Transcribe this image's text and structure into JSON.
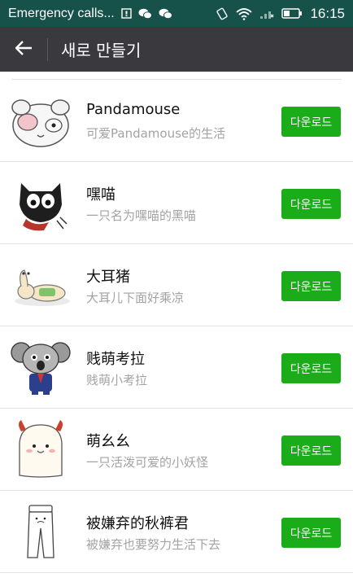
{
  "status_bar": {
    "carrier": "Emergency calls...",
    "time": "16:15",
    "left_icons": [
      "notification-icon",
      "wechat-icon",
      "wechat-icon"
    ],
    "right_icons": [
      "vibrate-icon",
      "wifi-icon",
      "signal-icon",
      "battery-icon"
    ]
  },
  "header": {
    "back_icon": "back-arrow-icon",
    "title": "새로 만들기"
  },
  "colors": {
    "status_bar": "#16514a",
    "title_bar": "#3a3a3e",
    "accent_green": "#1aad19"
  },
  "sticker_packs": [
    {
      "title": "Pandamouse",
      "desc": "可爱Pandamouse的生活",
      "button": "다운로드",
      "thumb": "pandamouse-icon"
    },
    {
      "title": "嘿喵",
      "desc": "一只名为嘿喵的黑喵",
      "button": "다운로드",
      "thumb": "black-cat-icon"
    },
    {
      "title": "大耳猪",
      "desc": "大耳儿下面好乘凉",
      "button": "다운로드",
      "thumb": "big-ear-pig-icon"
    },
    {
      "title": "贱萌考拉",
      "desc": "贱萌小考拉",
      "button": "다운로드",
      "thumb": "koala-icon"
    },
    {
      "title": "萌幺幺",
      "desc": "一只活泼可爱的小妖怪",
      "button": "다운로드",
      "thumb": "little-monster-icon"
    },
    {
      "title": "被嫌弃的秋裤君",
      "desc": "被嫌弃也要努力生活下去",
      "button": "다운로드",
      "thumb": "long-johns-icon"
    }
  ]
}
